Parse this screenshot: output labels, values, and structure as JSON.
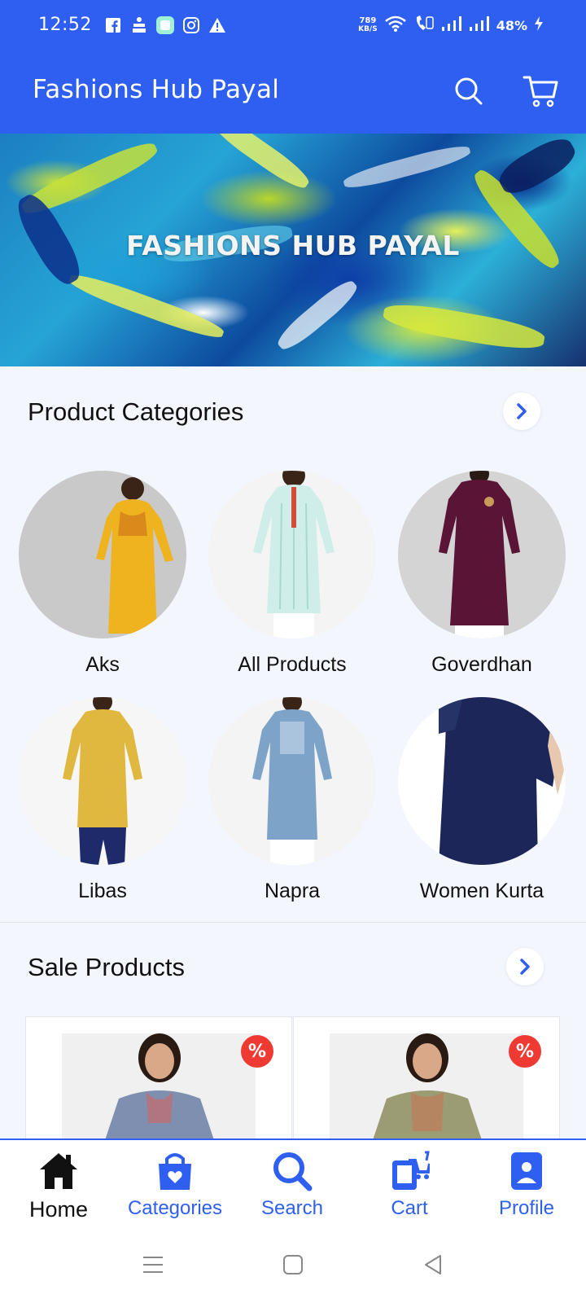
{
  "status_bar": {
    "time": "12:52",
    "speed_value": "789",
    "speed_unit": "KB/S",
    "battery": "48%",
    "left_icons": [
      "facebook-icon",
      "cricket-app-icon",
      "message-app-icon",
      "instagram-icon",
      "warning-icon"
    ],
    "right_icons": [
      "wifi-icon",
      "volte-call-icon",
      "signal-1-icon",
      "signal-2-icon",
      "charging-icon"
    ]
  },
  "app_bar": {
    "title": "Fashions Hub Payal",
    "actions": [
      "search-icon",
      "cart-icon"
    ]
  },
  "banner": {
    "text": "FASHIONS HUB PAYAL"
  },
  "categories_section": {
    "title": "Product Categories",
    "items": [
      {
        "label": "Aks",
        "dress_color": "#f0b320",
        "bg": "#c9c9c9"
      },
      {
        "label": "All Products",
        "dress_color": "#cfeee9",
        "bg": "#f4f4f4"
      },
      {
        "label": "Goverdhan",
        "dress_color": "#5a1436",
        "bg": "#d4d4d4"
      },
      {
        "label": "Libas",
        "dress_color": "#e0b840",
        "bg": "#f6f6f6"
      },
      {
        "label": "Napra",
        "dress_color": "#7da3c9",
        "bg": "#f4f4f4"
      },
      {
        "label": "Women Kurta",
        "dress_color": "#1c2659",
        "bg": "#ffffff"
      }
    ]
  },
  "sale_section": {
    "title": "Sale Products",
    "products": [
      {
        "badge": "%",
        "kurta_color": "#7f8fb0"
      },
      {
        "badge": "%",
        "kurta_color": "#9c9c74"
      }
    ]
  },
  "bottom_nav": {
    "items": [
      {
        "label": "Home",
        "icon": "home-icon",
        "active": true
      },
      {
        "label": "Categories",
        "icon": "shopping-bag-icon",
        "active": false
      },
      {
        "label": "Search",
        "icon": "search-icon",
        "active": false
      },
      {
        "label": "Cart",
        "icon": "cart-icon",
        "active": false
      },
      {
        "label": "Profile",
        "icon": "profile-icon",
        "active": false
      }
    ]
  },
  "colors": {
    "primary": "#2f5ff0",
    "background": "#f3f6fd",
    "sale_badge": "#ee3a32",
    "nav_active": "#111111",
    "nav_inactive": "#2f5ff0"
  }
}
